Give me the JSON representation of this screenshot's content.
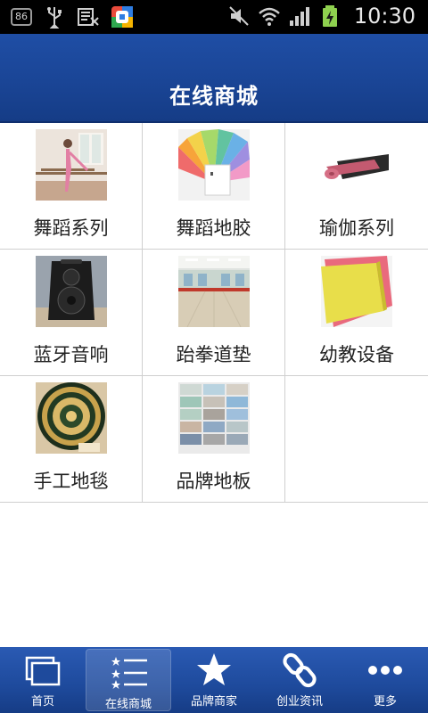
{
  "status_bar": {
    "badge": "86",
    "time": "10:30",
    "icons": [
      "usb-icon",
      "keyboard-icon",
      "app-store-icon",
      "mute-icon",
      "wifi-icon",
      "signal-icon",
      "battery-charging-icon"
    ]
  },
  "header": {
    "title": "在线商城"
  },
  "grid": {
    "items": [
      {
        "label": "舞蹈系列",
        "image": "dance-barre-photo"
      },
      {
        "label": "舞蹈地胶",
        "image": "dance-floor-swatches-photo"
      },
      {
        "label": "瑜伽系列",
        "image": "yoga-mat-photo"
      },
      {
        "label": "蓝牙音响",
        "image": "bluetooth-speaker-photo"
      },
      {
        "label": "跆拳道垫",
        "image": "taekwondo-mat-room-photo"
      },
      {
        "label": "幼教设备",
        "image": "preschool-mats-photo"
      },
      {
        "label": "手工地毯",
        "image": "handmade-carpet-photo"
      },
      {
        "label": "品牌地板",
        "image": "brand-flooring-photo"
      }
    ]
  },
  "bottom_nav": {
    "items": [
      {
        "label": "首页",
        "icon": "home-icon",
        "active": false
      },
      {
        "label": "在线商城",
        "icon": "list-icon",
        "active": true
      },
      {
        "label": "品牌商家",
        "icon": "star-icon",
        "active": false
      },
      {
        "label": "创业资讯",
        "icon": "link-icon",
        "active": false
      },
      {
        "label": "更多",
        "icon": "more-icon",
        "active": false
      }
    ]
  },
  "colors": {
    "header": "#1a4596",
    "nav": "#1e4a9c",
    "grid_border": "#cfcfcf"
  }
}
